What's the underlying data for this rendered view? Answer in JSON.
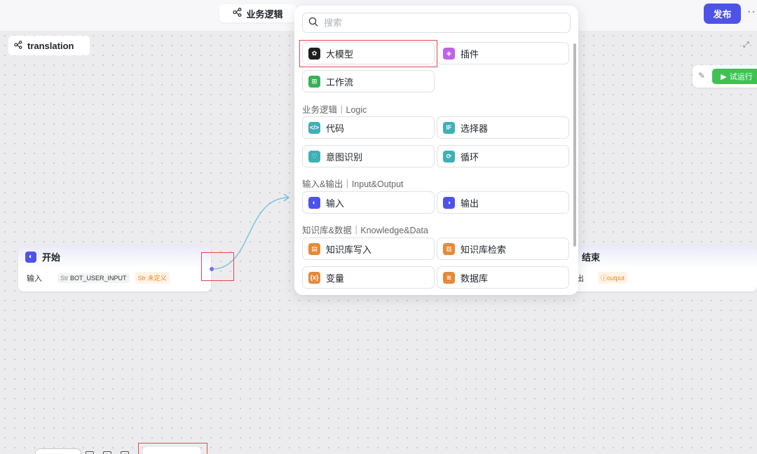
{
  "header": {
    "tab_label": "业务逻辑",
    "publish_label": "发布",
    "more_label": "···"
  },
  "flow": {
    "name": "translation"
  },
  "toolbar": {
    "run_label": "试运行"
  },
  "start_node": {
    "title": "开始",
    "row_label": "输入",
    "var_name": "BOT_USER_INPUT",
    "var_type": "Str",
    "status": "未定义",
    "status_type": "Str"
  },
  "end_node": {
    "title": "结束",
    "row_label": "出",
    "output_name": "output"
  },
  "panel": {
    "search_placeholder": "搜索",
    "top_items": [
      "大模型",
      "插件",
      "工作流"
    ],
    "sections": [
      {
        "title": "业务逻辑｜Logic",
        "items": [
          "代码",
          "选择器",
          "意图识别",
          "循环"
        ]
      },
      {
        "title": "输入&输出｜Input&Output",
        "items": [
          "输入",
          "输出"
        ]
      },
      {
        "title": "知识库&数据｜Knowledge&Data",
        "items": [
          "知识库写入",
          "知识库检索",
          "变量",
          "数据库"
        ]
      }
    ]
  },
  "colors": {
    "accent": "#4d53e8",
    "run": "#3ec254",
    "highlight": "#e04b4b",
    "edge": "#7dc4d9"
  }
}
